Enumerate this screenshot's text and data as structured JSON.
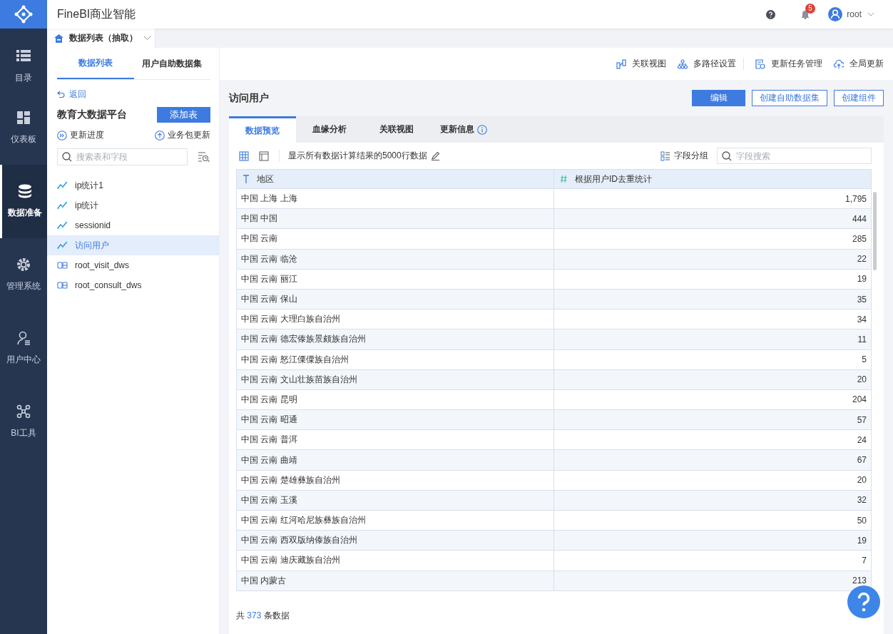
{
  "app": {
    "title": "FineBI商业智能",
    "notifications": "5",
    "user": "root"
  },
  "nav": [
    {
      "label": "目录",
      "selected": false
    },
    {
      "label": "仪表板",
      "selected": false
    },
    {
      "label": "数据准备",
      "selected": true
    },
    {
      "label": "管理系统",
      "selected": false
    },
    {
      "label": "用户中心",
      "selected": false
    },
    {
      "label": "BI工具",
      "selected": false
    }
  ],
  "page_tab": {
    "label": "数据列表（抽取）"
  },
  "panel_tabs": [
    {
      "label": "数据列表",
      "selected": true
    },
    {
      "label": "用户自助数据集",
      "selected": false
    }
  ],
  "toolbar": [
    {
      "label": "关联视图"
    },
    {
      "label": "多路径设置"
    },
    {
      "label": "更新任务管理"
    },
    {
      "label": "全局更新"
    }
  ],
  "sidebar": {
    "back": "返回",
    "package": "教育大数据平台",
    "add_button": "添加表",
    "progress": "更新进度",
    "package_update": "业务包更新",
    "search": {
      "placeholder": "搜索表和字段"
    },
    "items": [
      {
        "name": "ip统计1",
        "kind": "analysis",
        "selected": false
      },
      {
        "name": "ip统计",
        "kind": "analysis",
        "selected": false
      },
      {
        "name": "sessionid",
        "kind": "analysis",
        "selected": false
      },
      {
        "name": "访问用户",
        "kind": "analysis",
        "selected": true
      },
      {
        "name": "root_visit_dws",
        "kind": "db",
        "selected": false
      },
      {
        "name": "root_consult_dws",
        "kind": "db",
        "selected": false
      }
    ]
  },
  "detail": {
    "title": "访问用户",
    "buttons": [
      {
        "label": "编辑",
        "kind": "primary"
      },
      {
        "label": "创建自助数据集",
        "kind": "outline"
      },
      {
        "label": "创建组件",
        "kind": "outline"
      }
    ],
    "tabs": [
      {
        "label": "数据预览",
        "selected": true,
        "info": false
      },
      {
        "label": "血缘分析",
        "selected": false,
        "info": false
      },
      {
        "label": "关联视图",
        "selected": false,
        "info": false
      },
      {
        "label": "更新信息",
        "selected": false,
        "info": true
      }
    ],
    "row_limit": "显示所有数据计算结果的5000行数据",
    "field_group": "字段分组",
    "field_search": {
      "placeholder": "字段搜索"
    },
    "table": {
      "columns": [
        {
          "label": "地区",
          "kind": "text"
        },
        {
          "label": "根据用户ID去重统计",
          "kind": "number"
        }
      ],
      "rows": [
        [
          "中国 上海 上海",
          "1,795"
        ],
        [
          "中国 中国",
          "444"
        ],
        [
          "中国 云南",
          "285"
        ],
        [
          "中国 云南 临沧",
          "22"
        ],
        [
          "中国 云南 丽江",
          "19"
        ],
        [
          "中国 云南 保山",
          "35"
        ],
        [
          "中国 云南 大理白族自治州",
          "34"
        ],
        [
          "中国 云南 德宏傣族景颇族自治州",
          "11"
        ],
        [
          "中国 云南 怒江傈僳族自治州",
          "5"
        ],
        [
          "中国 云南 文山壮族苗族自治州",
          "20"
        ],
        [
          "中国 云南 昆明",
          "204"
        ],
        [
          "中国 云南 昭通",
          "57"
        ],
        [
          "中国 云南 普洱",
          "24"
        ],
        [
          "中国 云南 曲靖",
          "67"
        ],
        [
          "中国 云南 楚雄彝族自治州",
          "20"
        ],
        [
          "中国 云南 玉溪",
          "32"
        ],
        [
          "中国 云南 红河哈尼族彝族自治州",
          "50"
        ],
        [
          "中国 云南 西双版纳傣族自治州",
          "19"
        ],
        [
          "中国 云南 迪庆藏族自治州",
          "7"
        ],
        [
          "中国 内蒙古",
          "213"
        ]
      ]
    },
    "footer": {
      "prefix": "共",
      "count": "373",
      "suffix": "条数据"
    }
  }
}
